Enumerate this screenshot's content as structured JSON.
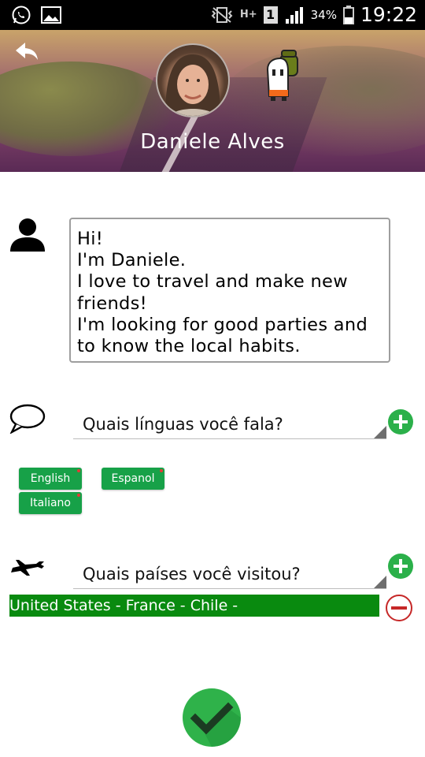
{
  "status_bar": {
    "battery_percent": "34%",
    "time": "19:22",
    "network_label": "H+",
    "sim_label": "1"
  },
  "profile": {
    "name": "Daniele Alves"
  },
  "bio": {
    "text": "Hi!\nI'm Daniele.\nI love to travel and make new friends!\nI'm looking for good parties and to know the local habits."
  },
  "languages": {
    "prompt": "Quais línguas você fala?",
    "chips": [
      "English",
      "Espanol",
      "Italiano"
    ]
  },
  "countries": {
    "prompt": "Quais países você visitou?",
    "visited": "United States - France - Chile -"
  },
  "colors": {
    "accent_green": "#2bb04a",
    "chip_green": "#17a148",
    "bar_green": "#098a0f",
    "remove_red": "#c62828"
  },
  "icons": {
    "back": "back-arrow-icon",
    "person": "person-icon",
    "speech": "speech-bubble-icon",
    "plane": "airplane-icon",
    "add": "add-circle-icon",
    "remove": "remove-circle-icon",
    "confirm": "checkmark-icon"
  }
}
